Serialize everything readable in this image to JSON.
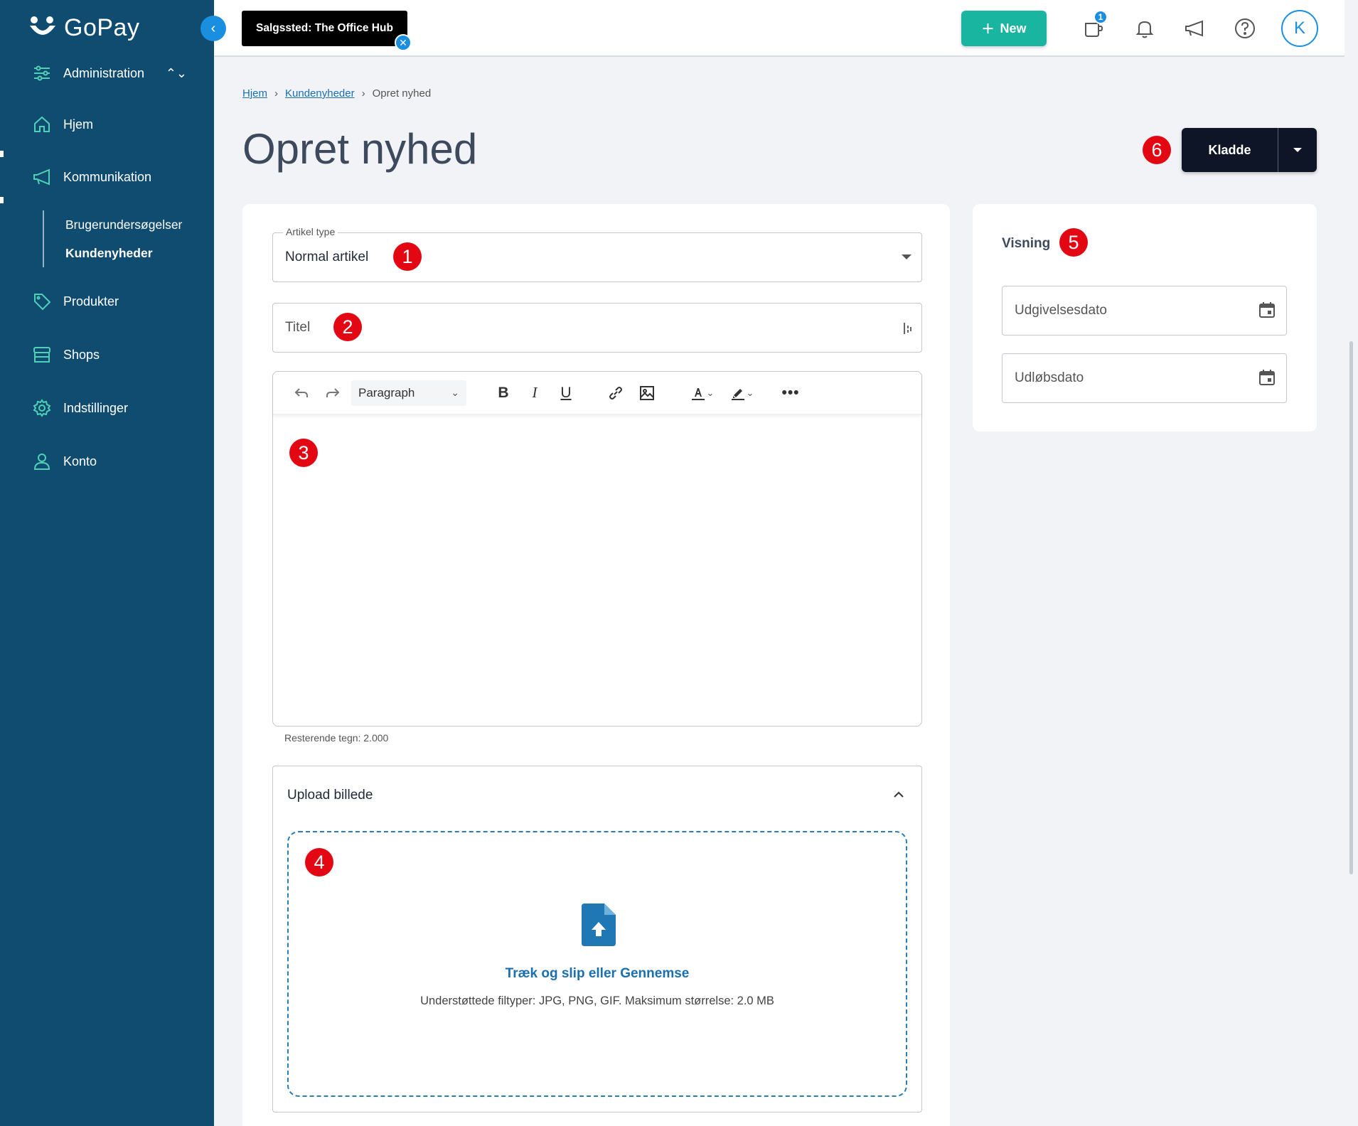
{
  "app": {
    "name": "GoPay"
  },
  "sidebar": {
    "admin_label": "Administration",
    "items": [
      {
        "label": "Hjem",
        "icon": "home-icon"
      },
      {
        "label": "Kommunikation",
        "icon": "megaphone-icon"
      },
      {
        "label": "Produkter",
        "icon": "tag-icon"
      },
      {
        "label": "Shops",
        "icon": "store-icon"
      },
      {
        "label": "Indstillinger",
        "icon": "gear-icon"
      },
      {
        "label": "Konto",
        "icon": "user-icon"
      }
    ],
    "sub_items": [
      {
        "label": "Brugerundersøgelser"
      },
      {
        "label": "Kundenyheder"
      }
    ]
  },
  "topbar": {
    "store_badge": "Salgssted: The Office Hub",
    "new_button": "New",
    "notification_count": "1",
    "avatar_initial": "K"
  },
  "breadcrumb": {
    "home": "Hjem",
    "section": "Kundenyheder",
    "current": "Opret nyhed"
  },
  "page": {
    "title": "Opret nyhed",
    "status_button": "Kladde"
  },
  "form": {
    "article_type_label": "Artikel type",
    "article_type_value": "Normal artikel",
    "title_placeholder": "Titel",
    "editor": {
      "block_format": "Paragraph"
    },
    "remaining_chars": "Resterende tegn: 2.000",
    "upload": {
      "title": "Upload billede",
      "drop_text": "Træk og slip eller Gennemse",
      "supported_text": "Understøttede filtyper: JPG, PNG, GIF. Maksimum størrelse: 2.0 MB"
    }
  },
  "visning": {
    "title": "Visning",
    "publish_date_placeholder": "Udgivelsesdato",
    "expiry_date_placeholder": "Udløbsdato"
  },
  "markers": [
    "1",
    "2",
    "3",
    "4",
    "5",
    "6"
  ],
  "colors": {
    "sidebar": "#0f4c6f",
    "accent": "#1a8fe0",
    "new_button": "#1ab5a0",
    "marker": "#e30613",
    "dark_button": "#0d1526"
  }
}
